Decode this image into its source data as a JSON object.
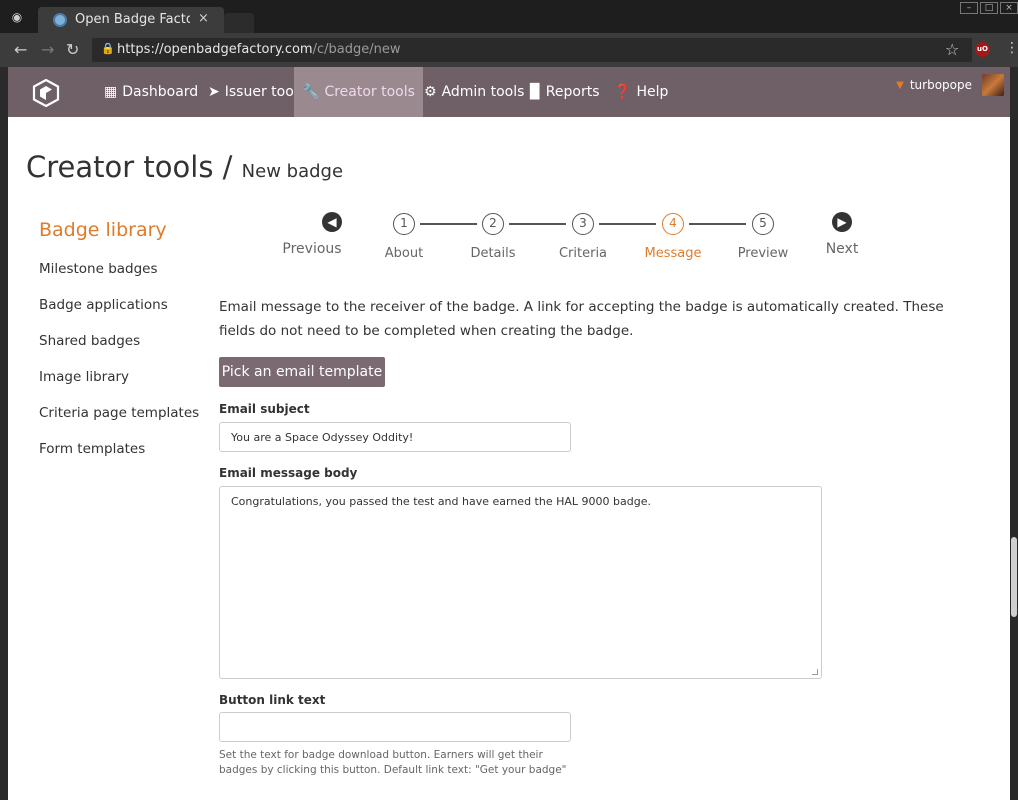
{
  "browser": {
    "tab_title": "Open Badge Factory",
    "tab_close": "×",
    "url_host": "https://openbadgefactory.com",
    "url_path": "/c/badge/new"
  },
  "nav": {
    "items": [
      {
        "label": "Dashboard",
        "icon": "grid-icon"
      },
      {
        "label": "Issuer tools",
        "icon": "paper-plane-icon"
      },
      {
        "label": "Creator tools",
        "icon": "wrench-icon",
        "active": true
      },
      {
        "label": "Admin tools",
        "icon": "gear-icon"
      },
      {
        "label": "Reports",
        "icon": "bar-chart-icon"
      },
      {
        "label": "Help",
        "icon": "question-circle-icon"
      }
    ],
    "user": "turbopope"
  },
  "page": {
    "title": "Creator tools",
    "title_sep": " / ",
    "subtitle": "New badge"
  },
  "sidebar": {
    "heading": "Badge library",
    "links": [
      "Milestone badges",
      "Badge applications",
      "Shared badges",
      "Image library",
      "Criteria page templates",
      "Form templates"
    ]
  },
  "wizard": {
    "previous": "Previous",
    "next": "Next",
    "steps": [
      {
        "num": "1",
        "label": "About"
      },
      {
        "num": "2",
        "label": "Details"
      },
      {
        "num": "3",
        "label": "Criteria"
      },
      {
        "num": "4",
        "label": "Message",
        "active": true
      },
      {
        "num": "5",
        "label": "Preview"
      }
    ]
  },
  "form": {
    "intro": "Email message to the receiver of the badge. A link for accepting the badge is automatically created. These fields do not need to be completed when creating the badge.",
    "pick_template": "Pick an email template",
    "subject_label": "Email subject",
    "subject_value": "You are a Space Odyssey Oddity!",
    "body_label": "Email message body",
    "body_value": "Congratulations, you passed the test and have earned the HAL 9000 badge.",
    "button_link_label": "Button link text",
    "button_link_value": "",
    "button_link_help": "Set the text for badge download button. Earners will get their badges by clicking this button. Default link text: \"Get your badge\""
  },
  "colors": {
    "accent": "#e07b2a",
    "navbar": "#6f5f66",
    "button": "#7b6a72"
  }
}
